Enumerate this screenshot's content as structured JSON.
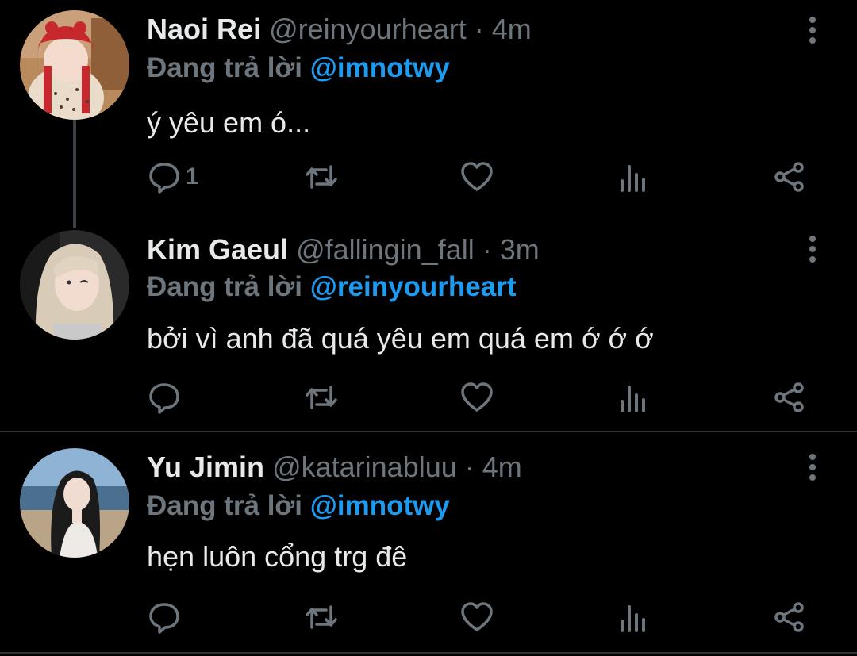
{
  "tweets": [
    {
      "name": "Naoi Rei",
      "handle": "@reinyourheart",
      "dot": " · ",
      "time": "4m",
      "reply_prefix": "Đang trả lời ",
      "reply_to": "@imnotwy",
      "text": "ý yêu em ó...",
      "reply_count": "1"
    },
    {
      "name": "Kim Gaeul",
      "handle": "@fallingin_fall",
      "dot": " · ",
      "time": "3m",
      "reply_prefix": "Đang trả lời ",
      "reply_to": "@reinyourheart",
      "text": "bởi vì anh đã quá yêu em quá em ớ ớ ớ",
      "reply_count": ""
    },
    {
      "name": "Yu Jimin",
      "handle": "@katarinabluu",
      "dot": " · ",
      "time": "4m",
      "reply_prefix": "Đang trả lời ",
      "reply_to": "@imnotwy",
      "text": "hẹn luôn cổng trg đê",
      "reply_count": ""
    }
  ],
  "icons": {
    "reply": "reply-icon",
    "retweet": "retweet-icon",
    "like": "heart-icon",
    "analytics": "analytics-icon",
    "share": "share-icon",
    "more": "more-vertical-icon"
  },
  "colors": {
    "background": "#000000",
    "name": "#e7e9ea",
    "muted": "#6e767d",
    "mention": "#1d9bf0",
    "divider": "#2f3336"
  }
}
